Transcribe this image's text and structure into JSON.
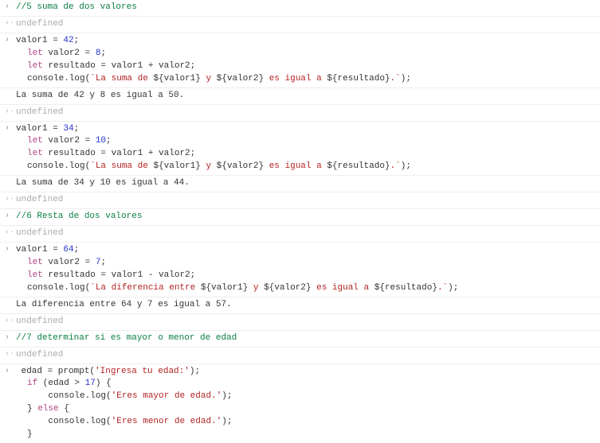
{
  "rows": [
    {
      "type": "in",
      "kind": "comment",
      "text": "//5 suma de dos valores"
    },
    {
      "type": "out",
      "kind": "undef"
    },
    {
      "type": "in",
      "kind": "sumcode",
      "v1": "42",
      "v2": "8"
    },
    {
      "type": "log",
      "text": "La suma de 42 y 8 es igual a 50."
    },
    {
      "type": "out",
      "kind": "undef"
    },
    {
      "type": "in",
      "kind": "sumcode",
      "v1": "34",
      "v2": "10"
    },
    {
      "type": "log",
      "text": "La suma de 34 y 10 es igual a 44."
    },
    {
      "type": "out",
      "kind": "undef"
    },
    {
      "type": "in",
      "kind": "comment",
      "text": "//6 Resta de dos valores"
    },
    {
      "type": "out",
      "kind": "undef"
    },
    {
      "type": "in",
      "kind": "diffcode",
      "v1": "64",
      "v2": "7"
    },
    {
      "type": "log",
      "text": "La diferencia entre 64 y 7 es igual a 57."
    },
    {
      "type": "out",
      "kind": "undef"
    },
    {
      "type": "in",
      "kind": "comment",
      "text": "//7 determinar si es mayor o menor de edad"
    },
    {
      "type": "out",
      "kind": "undef"
    },
    {
      "type": "in",
      "kind": "agecode",
      "prompt": "'Ingresa tu edad:'",
      "cond": "17",
      "msg1": "'Eres mayor de edad.'",
      "msg2": "'Eres menor de edad.'"
    }
  ],
  "tokens": {
    "undefined": "undefined",
    "let": "let",
    "if": "if",
    "else": "else",
    "valor1": "valor1",
    "valor2": "valor2",
    "resultado": "resultado",
    "consolelog": "console.log",
    "sum_assign": " = valor1 + valor2;",
    "diff_assign": " = valor1 - valor2;",
    "sum_tmpl_a": "`La suma de ",
    "sum_tmpl_b": " y ",
    "sum_tmpl_c": " es igual a ",
    "sum_tmpl_d": ".`",
    "diff_tmpl_a": "`La diferencia entre ",
    "diff_tmpl_d": ".`",
    "tpl_v1": "${valor1}",
    "tpl_v2": "${valor2}",
    "tpl_res": "${resultado}",
    "edad": "edad",
    "prompt": "prompt"
  }
}
